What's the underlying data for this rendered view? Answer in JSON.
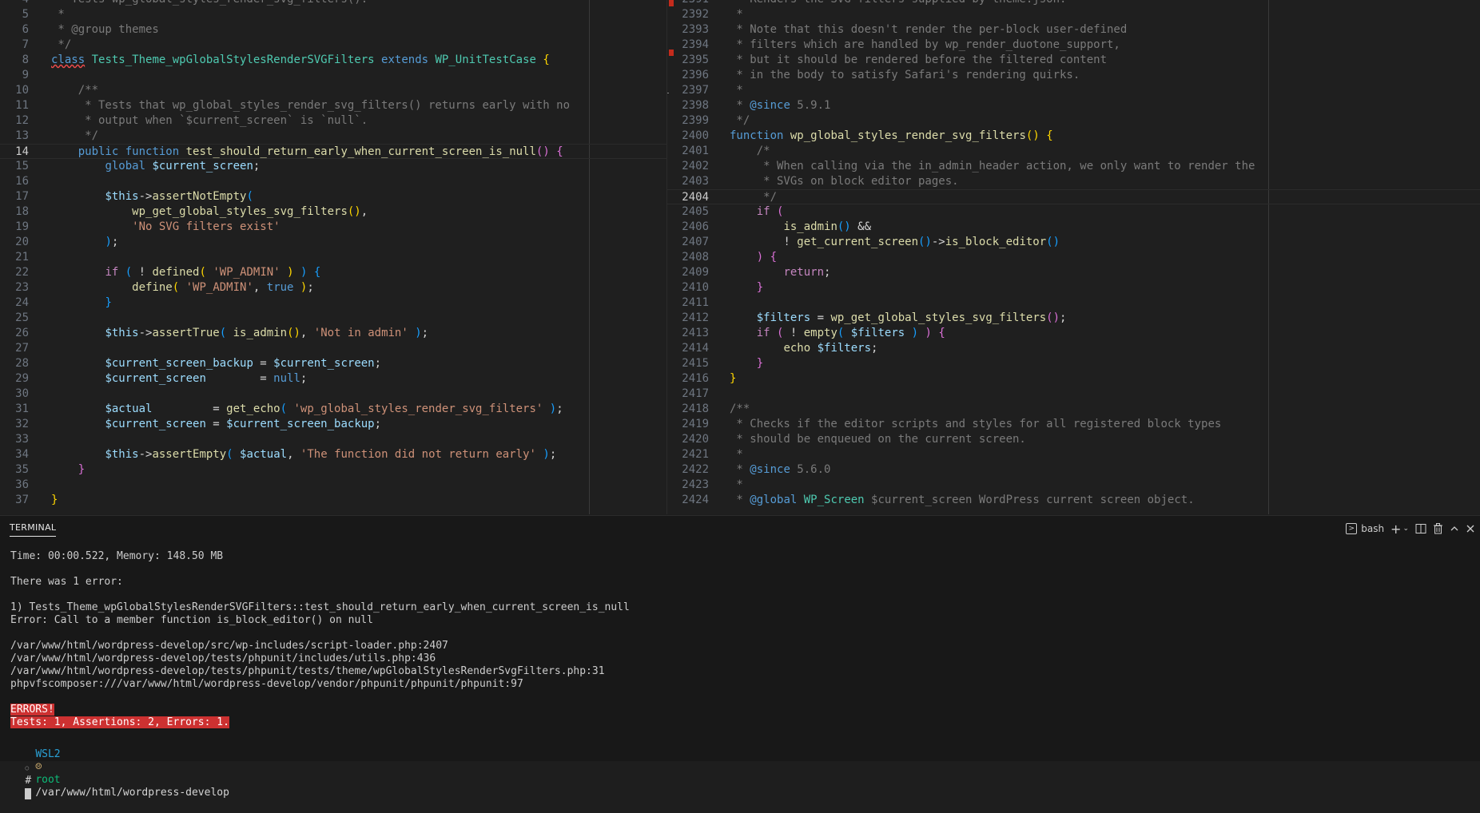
{
  "left_editor": {
    "lines": [
      {
        "n": "4",
        "t": [
          [
            "cm",
            " * Tests wp_global_styles_render_svg_filters()."
          ]
        ]
      },
      {
        "n": "5",
        "t": [
          [
            "cm",
            " *"
          ]
        ]
      },
      {
        "n": "6",
        "t": [
          [
            "cm",
            " * @group themes"
          ]
        ]
      },
      {
        "n": "7",
        "t": [
          [
            "cm",
            " */"
          ]
        ]
      },
      {
        "n": "8",
        "t": [
          [
            "kw err",
            "class"
          ],
          [
            "op",
            " "
          ],
          [
            "cls",
            "Tests_Theme_wpGlobalStylesRenderSVGFilters"
          ],
          [
            "op",
            " "
          ],
          [
            "kw",
            "extends"
          ],
          [
            "op",
            " "
          ],
          [
            "cls",
            "WP_UnitTestCase"
          ],
          [
            "op",
            " "
          ],
          [
            "br1",
            "{"
          ]
        ]
      },
      {
        "n": "9",
        "t": []
      },
      {
        "n": "10",
        "t": [
          [
            "cm",
            "    /**"
          ]
        ]
      },
      {
        "n": "11",
        "t": [
          [
            "cm",
            "     * Tests that wp_global_styles_render_svg_filters() returns early with no"
          ]
        ]
      },
      {
        "n": "12",
        "t": [
          [
            "cm",
            "     * output when `$current_screen` is `null`."
          ]
        ]
      },
      {
        "n": "13",
        "t": [
          [
            "cm",
            "     */"
          ]
        ]
      },
      {
        "n": "14",
        "current": true,
        "t": [
          [
            "op",
            "    "
          ],
          [
            "kw",
            "public"
          ],
          [
            "op",
            " "
          ],
          [
            "kw",
            "function"
          ],
          [
            "op",
            " "
          ],
          [
            "fn",
            "test_should_return_early_when_current_screen_is_null"
          ],
          [
            "br2",
            "()"
          ],
          [
            "op",
            " "
          ],
          [
            "br2",
            "{"
          ]
        ]
      },
      {
        "n": "15",
        "t": [
          [
            "op",
            "        "
          ],
          [
            "kw",
            "global"
          ],
          [
            "op",
            " "
          ],
          [
            "var",
            "$current_screen"
          ],
          [
            "op",
            ";"
          ]
        ]
      },
      {
        "n": "16",
        "t": []
      },
      {
        "n": "17",
        "t": [
          [
            "op",
            "        "
          ],
          [
            "var",
            "$this"
          ],
          [
            "op",
            "->"
          ],
          [
            "fn",
            "assertNotEmpty"
          ],
          [
            "br3",
            "("
          ]
        ]
      },
      {
        "n": "18",
        "t": [
          [
            "op",
            "            "
          ],
          [
            "fn",
            "wp_get_global_styles_svg_filters"
          ],
          [
            "br1",
            "()"
          ],
          [
            "op",
            ","
          ]
        ]
      },
      {
        "n": "19",
        "t": [
          [
            "op",
            "            "
          ],
          [
            "str",
            "'No SVG filters exist'"
          ]
        ]
      },
      {
        "n": "20",
        "t": [
          [
            "op",
            "        "
          ],
          [
            "br3",
            ")"
          ],
          [
            "op",
            ";"
          ]
        ]
      },
      {
        "n": "21",
        "t": []
      },
      {
        "n": "22",
        "t": [
          [
            "op",
            "        "
          ],
          [
            "ctl",
            "if"
          ],
          [
            "op",
            " "
          ],
          [
            "br3",
            "("
          ],
          [
            "op",
            " ! "
          ],
          [
            "fn",
            "defined"
          ],
          [
            "br1",
            "("
          ],
          [
            "op",
            " "
          ],
          [
            "str",
            "'WP_ADMIN'"
          ],
          [
            "op",
            " "
          ],
          [
            "br1",
            ")"
          ],
          [
            "op",
            " "
          ],
          [
            "br3",
            ")"
          ],
          [
            "op",
            " "
          ],
          [
            "br3",
            "{"
          ]
        ]
      },
      {
        "n": "23",
        "t": [
          [
            "op",
            "            "
          ],
          [
            "fn",
            "define"
          ],
          [
            "br1",
            "("
          ],
          [
            "op",
            " "
          ],
          [
            "str",
            "'WP_ADMIN'"
          ],
          [
            "op",
            ", "
          ],
          [
            "kw",
            "true"
          ],
          [
            "op",
            " "
          ],
          [
            "br1",
            ")"
          ],
          [
            "op",
            ";"
          ]
        ]
      },
      {
        "n": "24",
        "t": [
          [
            "op",
            "        "
          ],
          [
            "br3",
            "}"
          ]
        ]
      },
      {
        "n": "25",
        "t": []
      },
      {
        "n": "26",
        "t": [
          [
            "op",
            "        "
          ],
          [
            "var",
            "$this"
          ],
          [
            "op",
            "->"
          ],
          [
            "fn",
            "assertTrue"
          ],
          [
            "br3",
            "("
          ],
          [
            "op",
            " "
          ],
          [
            "fn",
            "is_admin"
          ],
          [
            "br1",
            "()"
          ],
          [
            "op",
            ", "
          ],
          [
            "str",
            "'Not in admin'"
          ],
          [
            "op",
            " "
          ],
          [
            "br3",
            ")"
          ],
          [
            "op",
            ";"
          ]
        ]
      },
      {
        "n": "27",
        "t": []
      },
      {
        "n": "28",
        "t": [
          [
            "op",
            "        "
          ],
          [
            "var",
            "$current_screen_backup"
          ],
          [
            "op",
            " = "
          ],
          [
            "var",
            "$current_screen"
          ],
          [
            "op",
            ";"
          ]
        ]
      },
      {
        "n": "29",
        "t": [
          [
            "op",
            "        "
          ],
          [
            "var",
            "$current_screen"
          ],
          [
            "op",
            "        = "
          ],
          [
            "kw",
            "null"
          ],
          [
            "op",
            ";"
          ]
        ]
      },
      {
        "n": "30",
        "t": []
      },
      {
        "n": "31",
        "t": [
          [
            "op",
            "        "
          ],
          [
            "var",
            "$actual"
          ],
          [
            "op",
            "         = "
          ],
          [
            "fn",
            "get_echo"
          ],
          [
            "br3",
            "("
          ],
          [
            "op",
            " "
          ],
          [
            "str",
            "'wp_global_styles_render_svg_filters'"
          ],
          [
            "op",
            " "
          ],
          [
            "br3",
            ")"
          ],
          [
            "op",
            ";"
          ]
        ]
      },
      {
        "n": "32",
        "t": [
          [
            "op",
            "        "
          ],
          [
            "var",
            "$current_screen"
          ],
          [
            "op",
            " = "
          ],
          [
            "var",
            "$current_screen_backup"
          ],
          [
            "op",
            ";"
          ]
        ]
      },
      {
        "n": "33",
        "t": []
      },
      {
        "n": "34",
        "t": [
          [
            "op",
            "        "
          ],
          [
            "var",
            "$this"
          ],
          [
            "op",
            "->"
          ],
          [
            "fn",
            "assertEmpty"
          ],
          [
            "br3",
            "("
          ],
          [
            "op",
            " "
          ],
          [
            "var",
            "$actual"
          ],
          [
            "op",
            ", "
          ],
          [
            "str",
            "'The function did not return early'"
          ],
          [
            "op",
            " "
          ],
          [
            "br3",
            ")"
          ],
          [
            "op",
            ";"
          ]
        ]
      },
      {
        "n": "35",
        "t": [
          [
            "op",
            "    "
          ],
          [
            "br2",
            "}"
          ]
        ]
      },
      {
        "n": "36",
        "t": []
      },
      {
        "n": "37",
        "t": [
          [
            "br1",
            "}"
          ]
        ]
      }
    ]
  },
  "right_editor": {
    "lines": [
      {
        "n": "2391",
        "t": [
          [
            "cm",
            " * Renders the SVG filters supplied by theme.json."
          ]
        ]
      },
      {
        "n": "2392",
        "t": [
          [
            "cm",
            " *"
          ]
        ]
      },
      {
        "n": "2393",
        "t": [
          [
            "cm",
            " * Note that this doesn't render the per-block user-defined"
          ]
        ]
      },
      {
        "n": "2394",
        "t": [
          [
            "cm",
            " * filters which are handled by wp_render_duotone_support,"
          ]
        ]
      },
      {
        "n": "2395",
        "t": [
          [
            "cm",
            " * but it should be rendered before the filtered content"
          ]
        ]
      },
      {
        "n": "2396",
        "t": [
          [
            "cm",
            " * in the body to satisfy Safari's rendering quirks."
          ]
        ]
      },
      {
        "n": "2397",
        "t": [
          [
            "cm",
            " *"
          ]
        ]
      },
      {
        "n": "2398",
        "t": [
          [
            "cm",
            " * "
          ],
          [
            "kw",
            "@since"
          ],
          [
            "cm",
            " 5.9.1"
          ]
        ]
      },
      {
        "n": "2399",
        "t": [
          [
            "cm",
            " */"
          ]
        ]
      },
      {
        "n": "2400",
        "t": [
          [
            "kw",
            "function"
          ],
          [
            "op",
            " "
          ],
          [
            "fn",
            "wp_global_styles_render_svg_filters"
          ],
          [
            "br1",
            "()"
          ],
          [
            "op",
            " "
          ],
          [
            "br1",
            "{"
          ]
        ]
      },
      {
        "n": "2401",
        "t": [
          [
            "cm",
            "    /*"
          ]
        ]
      },
      {
        "n": "2402",
        "t": [
          [
            "cm",
            "     * When calling via the in_admin_header action, we only want to render the"
          ]
        ]
      },
      {
        "n": "2403",
        "t": [
          [
            "cm",
            "     * SVGs on block editor pages."
          ]
        ]
      },
      {
        "n": "2404",
        "current": true,
        "t": [
          [
            "cm",
            "     */"
          ]
        ]
      },
      {
        "n": "2405",
        "t": [
          [
            "op",
            "    "
          ],
          [
            "ctl",
            "if"
          ],
          [
            "op",
            " "
          ],
          [
            "br2",
            "("
          ]
        ]
      },
      {
        "n": "2406",
        "t": [
          [
            "op",
            "        "
          ],
          [
            "fn",
            "is_admin"
          ],
          [
            "br3",
            "()"
          ],
          [
            "op",
            " &&"
          ]
        ]
      },
      {
        "n": "2407",
        "t": [
          [
            "op",
            "        ! "
          ],
          [
            "fn",
            "get_current_screen"
          ],
          [
            "br3",
            "()"
          ],
          [
            "op",
            "->"
          ],
          [
            "fn",
            "is_block_editor"
          ],
          [
            "br3",
            "()"
          ]
        ]
      },
      {
        "n": "2408",
        "t": [
          [
            "op",
            "    "
          ],
          [
            "br2",
            ")"
          ],
          [
            "op",
            " "
          ],
          [
            "br2",
            "{"
          ]
        ]
      },
      {
        "n": "2409",
        "t": [
          [
            "op",
            "        "
          ],
          [
            "ctl",
            "return"
          ],
          [
            "op",
            ";"
          ]
        ]
      },
      {
        "n": "2410",
        "t": [
          [
            "op",
            "    "
          ],
          [
            "br2",
            "}"
          ]
        ]
      },
      {
        "n": "2411",
        "t": []
      },
      {
        "n": "2412",
        "t": [
          [
            "op",
            "    "
          ],
          [
            "var",
            "$filters"
          ],
          [
            "op",
            " = "
          ],
          [
            "fn",
            "wp_get_global_styles_svg_filters"
          ],
          [
            "br2",
            "()"
          ],
          [
            "op",
            ";"
          ]
        ]
      },
      {
        "n": "2413",
        "t": [
          [
            "op",
            "    "
          ],
          [
            "ctl",
            "if"
          ],
          [
            "op",
            " "
          ],
          [
            "br2",
            "("
          ],
          [
            "op",
            " ! "
          ],
          [
            "fn",
            "empty"
          ],
          [
            "br3",
            "("
          ],
          [
            "op",
            " "
          ],
          [
            "var",
            "$filters"
          ],
          [
            "op",
            " "
          ],
          [
            "br3",
            ")"
          ],
          [
            "op",
            " "
          ],
          [
            "br2",
            ")"
          ],
          [
            "op",
            " "
          ],
          [
            "br2",
            "{"
          ]
        ]
      },
      {
        "n": "2414",
        "t": [
          [
            "op",
            "        "
          ],
          [
            "fn",
            "echo"
          ],
          [
            "op",
            " "
          ],
          [
            "var",
            "$filters"
          ],
          [
            "op",
            ";"
          ]
        ]
      },
      {
        "n": "2415",
        "t": [
          [
            "op",
            "    "
          ],
          [
            "br2",
            "}"
          ]
        ]
      },
      {
        "n": "2416",
        "t": [
          [
            "br1",
            "}"
          ]
        ]
      },
      {
        "n": "2417",
        "t": []
      },
      {
        "n": "2418",
        "t": [
          [
            "cm",
            "/**"
          ]
        ]
      },
      {
        "n": "2419",
        "t": [
          [
            "cm",
            " * Checks if the editor scripts and styles for all registered block types"
          ]
        ]
      },
      {
        "n": "2420",
        "t": [
          [
            "cm",
            " * should be enqueued on the current screen."
          ]
        ]
      },
      {
        "n": "2421",
        "t": [
          [
            "cm",
            " *"
          ]
        ]
      },
      {
        "n": "2422",
        "t": [
          [
            "cm",
            " * "
          ],
          [
            "kw",
            "@since"
          ],
          [
            "cm",
            " 5.6.0"
          ]
        ]
      },
      {
        "n": "2423",
        "t": [
          [
            "cm",
            " *"
          ]
        ]
      },
      {
        "n": "2424",
        "t": [
          [
            "cm",
            " * "
          ],
          [
            "kw",
            "@global"
          ],
          [
            "op",
            " "
          ],
          [
            "cls",
            "WP_Screen"
          ],
          [
            "cm",
            " $current_screen WordPress current screen object."
          ]
        ]
      }
    ]
  },
  "terminal": {
    "tab_label": "TERMINAL",
    "shell_label": "bash",
    "lines": [
      {
        "t": "Time: 00:00.522, Memory: 148.50 MB"
      },
      {
        "t": ""
      },
      {
        "t": "There was 1 error:"
      },
      {
        "t": ""
      },
      {
        "t": "1) Tests_Theme_wpGlobalStylesRenderSVGFilters::test_should_return_early_when_current_screen_is_null"
      },
      {
        "t": "Error: Call to a member function is_block_editor() on null"
      },
      {
        "t": ""
      },
      {
        "t": "/var/www/html/wordpress-develop/src/wp-includes/script-loader.php:2407"
      },
      {
        "t": "/var/www/html/wordpress-develop/tests/phpunit/includes/utils.php:436"
      },
      {
        "t": "/var/www/html/wordpress-develop/tests/phpunit/tests/theme/wpGlobalStylesRenderSvgFilters.php:31"
      },
      {
        "t": "phpvfscomposer:///var/www/html/wordpress-develop/vendor/phpunit/phpunit/phpunit:97"
      },
      {
        "t": ""
      },
      {
        "t": "ERRORS!",
        "err": true
      },
      {
        "t": "Tests: 1, Assertions: 2, Errors: 1.",
        "err": true
      }
    ],
    "prompt": {
      "wsl": "WSL2",
      "face": "☹",
      "user": "root",
      "path": "/var/www/html/wordpress-develop",
      "marker": "○",
      "symbol": "#"
    }
  }
}
